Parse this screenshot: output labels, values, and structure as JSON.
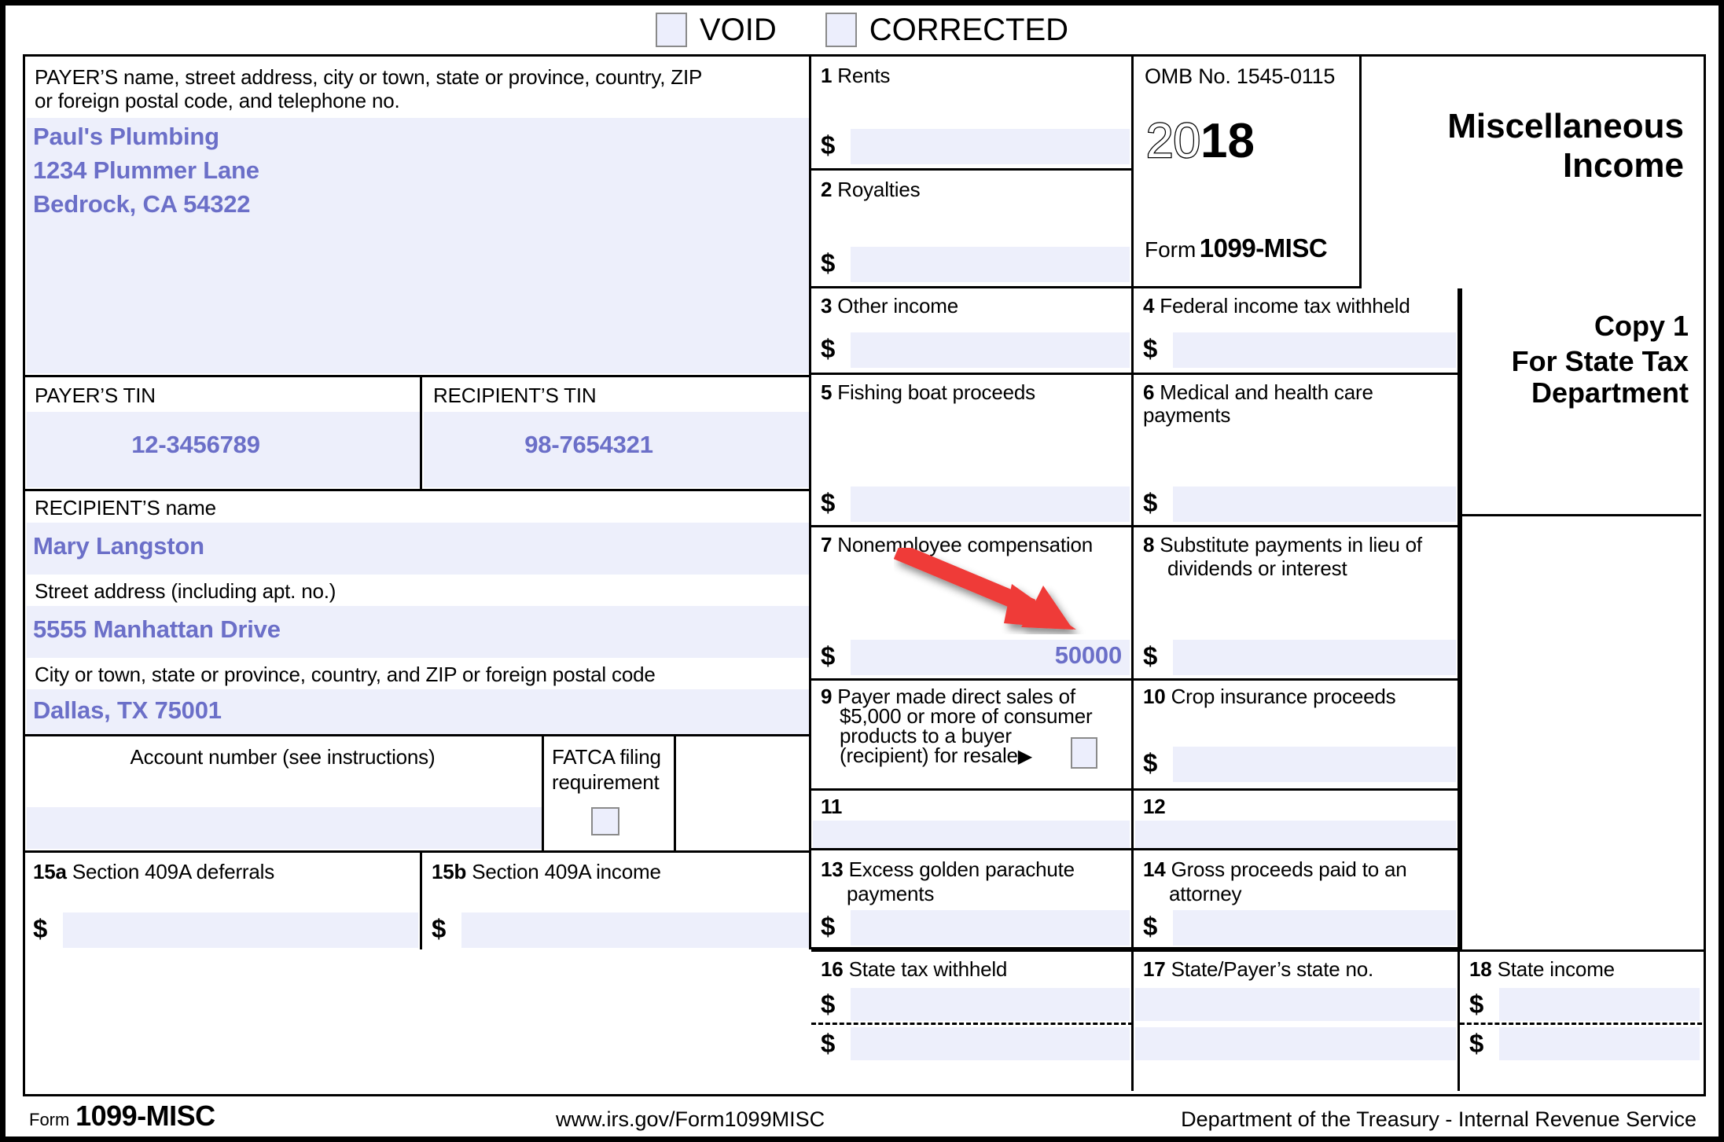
{
  "header": {
    "void_label": "VOID",
    "corrected_label": "CORRECTED",
    "void_checked": false,
    "corrected_checked": false
  },
  "payer": {
    "label_line1": "PAYER’S name, street address, city or town, state or province, country, ZIP",
    "label_line2": "or foreign postal code, and telephone no.",
    "name": "Paul's Plumbing",
    "street": "1234 Plummer Lane",
    "citystatezip": "Bedrock, CA 54322"
  },
  "tins": {
    "payer_tin_label": "PAYER’S TIN",
    "payer_tin_value": "12-3456789",
    "recipient_tin_label": "RECIPIENT’S TIN",
    "recipient_tin_value": "98-7654321"
  },
  "recipient": {
    "name_label": "RECIPIENT’S name",
    "name_value": "Mary Langston",
    "street_label": "Street address (including apt. no.)",
    "street_value": "5555 Manhattan Drive",
    "city_label": "City or town, state or province, country, and ZIP or foreign postal code",
    "city_value": "Dallas, TX 75001"
  },
  "account": {
    "label": "Account number (see instructions)",
    "value": "",
    "fatca_label_line1": "FATCA filing",
    "fatca_label_line2": "requirement",
    "fatca_checked": false
  },
  "omb": {
    "number": "OMB No. 1545-0115",
    "year_light": "20",
    "year_bold": "18",
    "form_prefix": "Form",
    "form_number": "1099-MISC"
  },
  "title": {
    "line1": "Miscellaneous",
    "line2": "Income"
  },
  "copy": {
    "line1": "Copy 1",
    "line2": "For State Tax",
    "line3": "Department"
  },
  "boxes": {
    "b1": {
      "num": "1",
      "label": "Rents",
      "currency": "$",
      "value": ""
    },
    "b2": {
      "num": "2",
      "label": "Royalties",
      "currency": "$",
      "value": ""
    },
    "b3": {
      "num": "3",
      "label": "Other income",
      "currency": "$",
      "value": ""
    },
    "b4": {
      "num": "4",
      "label": "Federal income tax withheld",
      "currency": "$",
      "value": ""
    },
    "b5": {
      "num": "5",
      "label": "Fishing boat proceeds",
      "currency": "$",
      "value": ""
    },
    "b6": {
      "num": "6",
      "label": "Medical and health care payments",
      "currency": "$",
      "value": ""
    },
    "b7": {
      "num": "7",
      "label": "Nonemployee compensation",
      "currency": "$",
      "value": "50000"
    },
    "b8": {
      "num": "8",
      "label_line1": "Substitute payments in lieu of",
      "label_line2": "dividends or interest",
      "currency": "$",
      "value": ""
    },
    "b9": {
      "num": "9",
      "label_line1": "Payer made direct sales of",
      "label_line2": "$5,000 or more of consumer",
      "label_line3": "products to a buyer",
      "label_line4": "(recipient) for resale",
      "arrow_glyph": "▶",
      "checked": false
    },
    "b10": {
      "num": "10",
      "label": "Crop insurance proceeds",
      "currency": "$",
      "value": ""
    },
    "b11": {
      "num": "11",
      "label": "",
      "value": ""
    },
    "b12": {
      "num": "12",
      "label": "",
      "value": ""
    },
    "b13": {
      "num": "13",
      "label_line1": "Excess golden parachute",
      "label_line2": "payments",
      "currency": "$",
      "value": ""
    },
    "b14": {
      "num": "14",
      "label_line1": "Gross proceeds paid to an",
      "label_line2": "attorney",
      "currency": "$",
      "value": ""
    },
    "b15a": {
      "num": "15a",
      "label": "Section 409A deferrals",
      "currency": "$",
      "value": ""
    },
    "b15b": {
      "num": "15b",
      "label": "Section 409A income",
      "currency": "$",
      "value": ""
    },
    "b16": {
      "num": "16",
      "label": "State tax withheld",
      "currency": "$",
      "value": "",
      "currency2": "$",
      "value2": ""
    },
    "b17": {
      "num": "17",
      "label": "State/Payer’s state no.",
      "value": "",
      "value2": ""
    },
    "b18": {
      "num": "18",
      "label": "State income",
      "currency": "$",
      "value": "",
      "currency2": "$",
      "value2": ""
    }
  },
  "footer": {
    "form_prefix": "Form",
    "form_number": "1099-MISC",
    "url": "www.irs.gov/Form1099MISC",
    "agency": "Department of the Treasury - Internal Revenue Service"
  },
  "annotation": {
    "arrow_color": "#ef3b38",
    "arrow_target": "box-7-amount"
  },
  "colors": {
    "field_fill": "#edeffb",
    "entry_text": "#6b6fc8",
    "rule": "#000000"
  }
}
